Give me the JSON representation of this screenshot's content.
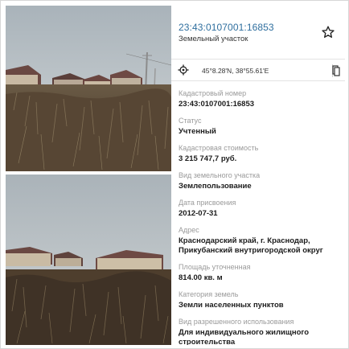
{
  "listing": {
    "cadastral_number_title": "23:43:0107001:16853",
    "land_type": "Земельный участок",
    "star_icon": "star-outline-icon",
    "location_icon": "crosshair-icon",
    "coordinates": "45°8.28'N, 38°55.61'E",
    "copy_icon": "copy-icon"
  },
  "fields": [
    {
      "label": "Кадастровый номер",
      "value": "23:43:0107001:16853"
    },
    {
      "label": "Статус",
      "value": "Учтенный"
    },
    {
      "label": "Кадастровая стоимость",
      "value": "3 215 747,7 руб."
    },
    {
      "label": "Вид земельного участка",
      "value": "Землепользование"
    },
    {
      "label": "Дата присвоения",
      "value": "2012-07-31"
    },
    {
      "label": "Адрес",
      "value": "Краснодарский край, г. Краснодар, Прикубанский внутригородской округ"
    },
    {
      "label": "Площадь уточненная",
      "value": "814.00 кв. м"
    },
    {
      "label": "Категория земель",
      "value": "Земли населенных пунктов"
    },
    {
      "label": "Вид разрешенного использования",
      "value": "Для индивидуального жилищного строительства"
    }
  ],
  "colors": {
    "link": "#2e6e9e",
    "label": "#9a9a9a",
    "sky": "#b9c2c8",
    "roof": "#6e4a44",
    "soil": "#5a4b3a"
  }
}
